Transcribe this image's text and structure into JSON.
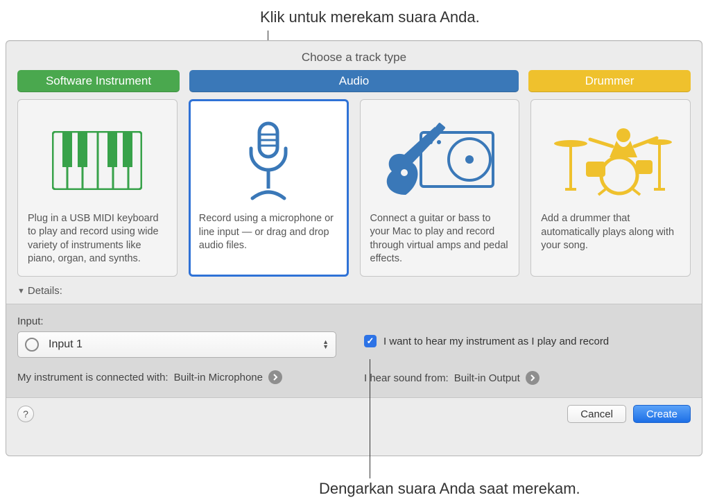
{
  "annotations": {
    "top": "Klik untuk merekam suara Anda.",
    "bottom": "Dengarkan suara Anda saat merekam."
  },
  "dialog": {
    "title": "Choose a track type",
    "tabs": {
      "software_instrument": "Software Instrument",
      "audio": "Audio",
      "drummer": "Drummer"
    },
    "cards": {
      "si": "Plug in a USB MIDI keyboard to play and record using wide variety of instruments like piano, organ, and synths.",
      "mic": "Record using a microphone or line input — or drag and drop audio files.",
      "guitar": "Connect a guitar or bass to your Mac to play and record through virtual amps and pedal effects.",
      "drummer": "Add a drummer that automatically plays along with your song."
    },
    "details_label": "Details:",
    "input": {
      "label": "Input:",
      "value": "Input 1"
    },
    "connection": {
      "prefix": "My instrument is connected with: ",
      "value": "Built-in Microphone"
    },
    "monitor_checkbox": "I want to hear my instrument as I play and record",
    "output": {
      "prefix": "I hear sound from: ",
      "value": "Built-in Output"
    },
    "buttons": {
      "cancel": "Cancel",
      "create": "Create"
    }
  }
}
